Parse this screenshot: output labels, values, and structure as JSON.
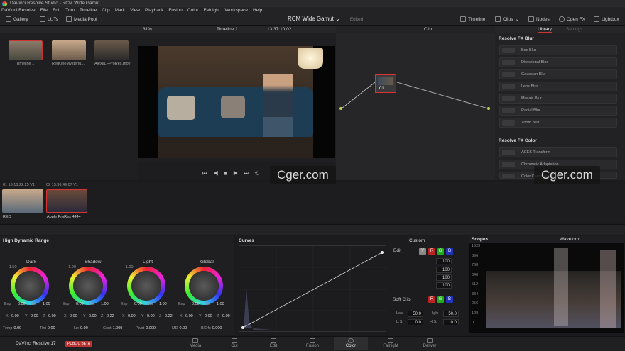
{
  "titlebar": {
    "title": "DaVinci Resolve Studio - RCM Wide Gamut"
  },
  "menu": [
    "DaVinci Resolve",
    "File",
    "Edit",
    "Trim",
    "Timeline",
    "Clip",
    "Mark",
    "View",
    "Playback",
    "Fusion",
    "Color",
    "Fairlight",
    "Workspace",
    "Help"
  ],
  "toolbar": {
    "gallery": "Gallery",
    "luts": "LUTs",
    "media_pool": "Media Pool",
    "project": "RCM Wide Gamut",
    "edited": "Edited",
    "timeline": "Timeline",
    "clips": "Clips",
    "nodes": "Nodes",
    "openfx": "Open FX",
    "lightbox": "Lightbox"
  },
  "viewer": {
    "zoom": "31%",
    "timeline": "Timeline 1",
    "timecode": "13:37:10:02",
    "clip": "Clip"
  },
  "media": [
    {
      "name": "Timeline 1"
    },
    {
      "name": "RedOneMysteriu..."
    },
    {
      "name": "AlexaLFProRes.mov"
    }
  ],
  "node": {
    "label": "01"
  },
  "library": {
    "tab_library": "Library",
    "tab_settings": "Settings",
    "blur_heading": "Resolve FX Blur",
    "blur": [
      "Box Blur",
      "Directional Blur",
      "Gaussian Blur",
      "Lens Blur",
      "Mosaic Blur",
      "Radial Blur",
      "Zoom Blur"
    ],
    "color_heading": "Resolve FX Color",
    "color": [
      "ACES Transform",
      "Chromatic Adaptation",
      "Color Compressor"
    ]
  },
  "clips": [
    {
      "num": "01",
      "tc": "19:15:22:25",
      "track": "V1",
      "name": "RED"
    },
    {
      "num": "02",
      "tc": "13:36:49:07",
      "track": "V1",
      "name": "Apple ProRes 4444"
    }
  ],
  "hdr": {
    "title": "High Dynamic Range",
    "wheels": [
      {
        "name": "Dark",
        "val": "-1.50",
        "x": "0.00",
        "y": "0.00",
        "z": "0.00",
        "exp": "0.00",
        "sat": "1.00"
      },
      {
        "name": "Shadow",
        "val": "+1.00",
        "x": "0.00",
        "y": "0.00",
        "z": "0.22",
        "exp": "0.00",
        "sat": "1.00"
      },
      {
        "name": "Light",
        "val": "-1.00",
        "x": "0.00",
        "y": "0.00",
        "z": "0.22",
        "exp": "0.00",
        "sat": "1.00"
      },
      {
        "name": "Global",
        "val": "",
        "x": "0.00",
        "y": "0.00",
        "z": "0.00",
        "exp": "0.00",
        "sat": "1.00"
      }
    ],
    "bottom": [
      {
        "l": "Temp",
        "v": "0.00"
      },
      {
        "l": "Tint",
        "v": "0.00"
      },
      {
        "l": "Hue",
        "v": "0.00"
      },
      {
        "l": "Cont",
        "v": "1.000"
      },
      {
        "l": "Pivot",
        "v": "0.000"
      },
      {
        "l": "MD",
        "v": "0.00"
      },
      {
        "l": "B/Ofs",
        "v": "0.000"
      }
    ]
  },
  "curves": {
    "title": "Curves",
    "mode": "Custom",
    "edit": "Edit",
    "vals": [
      "100",
      "100",
      "100",
      "100"
    ],
    "softclip": "Soft Clip",
    "low": "Low",
    "low_v": "50.0",
    "high": "High",
    "high_v": "50.0",
    "ls": "L.S.",
    "ls_v": "0.0",
    "hs": "H.S.",
    "hs_v": "0.0"
  },
  "scopes": {
    "title": "Scopes",
    "mode": "Waveform",
    "ticks": [
      "1023",
      "896",
      "768",
      "640",
      "512",
      "384",
      "256",
      "128",
      "0"
    ]
  },
  "pages": [
    "Media",
    "Cut",
    "Edit",
    "Fusion",
    "Color",
    "Fairlight",
    "Deliver"
  ],
  "app": {
    "name": "DaVinci Resolve 17",
    "badge": "PUBLIC BETA"
  },
  "watermark": "Cger.com"
}
